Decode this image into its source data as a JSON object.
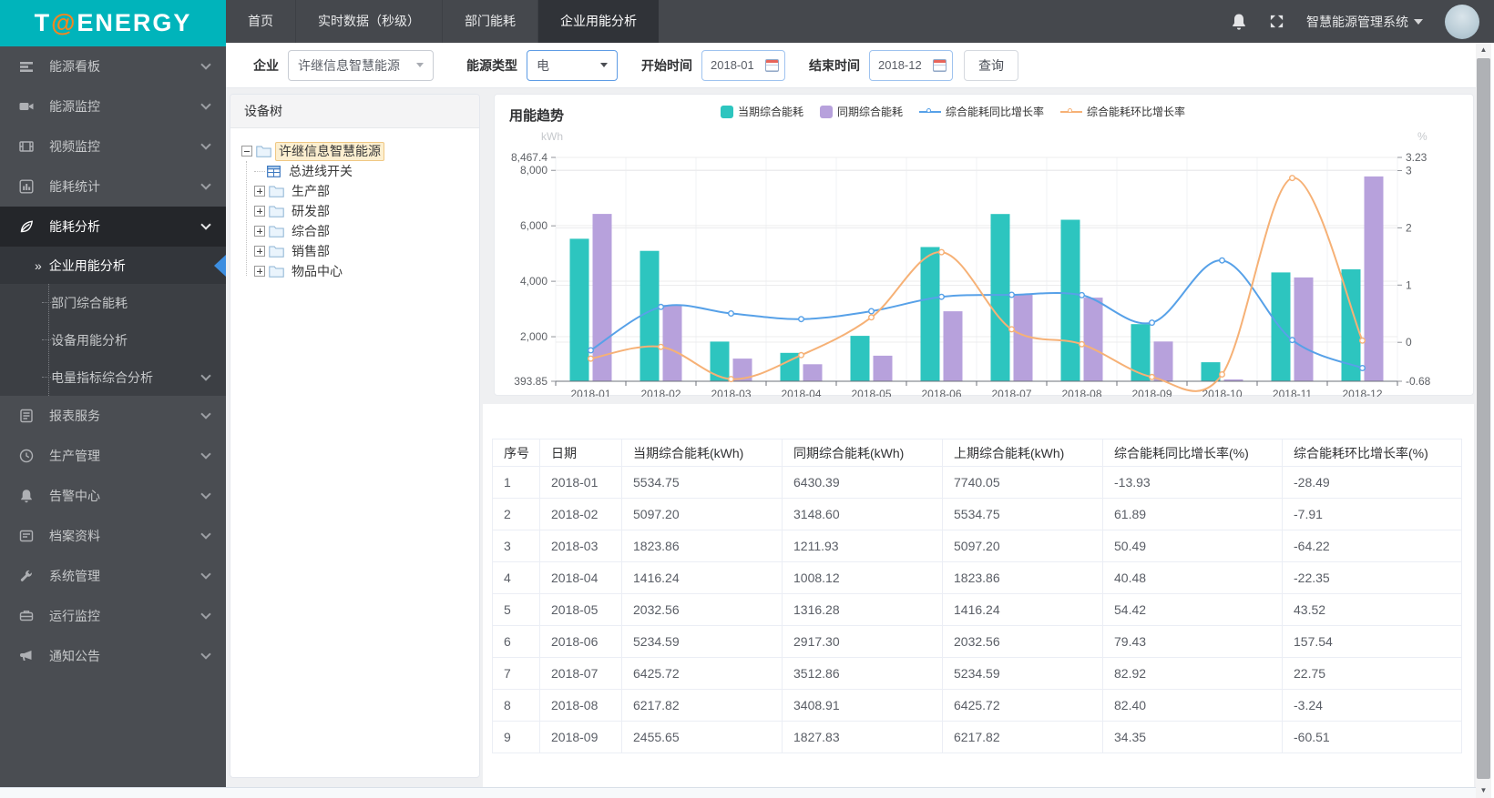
{
  "header": {
    "logo_part1": "T",
    "logo_at": "@",
    "logo_part2": "ENERGY",
    "tabs": [
      {
        "label": "首页",
        "active": false
      },
      {
        "label": "实时数据（秒级）",
        "active": false
      },
      {
        "label": "部门能耗",
        "active": false
      },
      {
        "label": "企业用能分析",
        "active": true
      }
    ],
    "system_name": "智慧能源管理系统"
  },
  "sidebar": {
    "items": [
      {
        "label": "能源看板",
        "icon": "dashboard-icon"
      },
      {
        "label": "能源监控",
        "icon": "camera-icon"
      },
      {
        "label": "视频监控",
        "icon": "film-icon"
      },
      {
        "label": "能耗统计",
        "icon": "bar-chart-icon"
      },
      {
        "label": "能耗分析",
        "icon": "leaf-icon",
        "active": true,
        "expanded": true,
        "children": [
          {
            "label": "企业用能分析",
            "active": true
          },
          {
            "label": "部门综合能耗"
          },
          {
            "label": "设备用能分析"
          },
          {
            "label": "电量指标综合分析",
            "has_children": true
          }
        ]
      },
      {
        "label": "报表服务",
        "icon": "report-icon"
      },
      {
        "label": "生产管理",
        "icon": "clock-icon"
      },
      {
        "label": "告警中心",
        "icon": "bell-icon"
      },
      {
        "label": "档案资料",
        "icon": "card-icon"
      },
      {
        "label": "系统管理",
        "icon": "wrench-icon"
      },
      {
        "label": "运行监控",
        "icon": "drive-icon"
      },
      {
        "label": "通知公告",
        "icon": "megaphone-icon"
      }
    ]
  },
  "filters": {
    "enterprise_label": "企业",
    "enterprise_value": "许继信息智慧能源",
    "energy_type_label": "能源类型",
    "energy_type_value": "电",
    "start_label": "开始时间",
    "start_value": "2018-01",
    "end_label": "结束时间",
    "end_value": "2018-12",
    "query_label": "查询"
  },
  "tree": {
    "title": "设备树",
    "nodes": [
      {
        "label": "许继信息智慧能源",
        "level": 0,
        "expander": "minus",
        "icon": "folder",
        "selected": true
      },
      {
        "label": "总进线开关",
        "level": 1,
        "expander": "none",
        "icon": "meter",
        "selected": false
      },
      {
        "label": "生产部",
        "level": 1,
        "expander": "plus",
        "icon": "folder",
        "selected": false
      },
      {
        "label": "研发部",
        "level": 1,
        "expander": "plus",
        "icon": "folder",
        "selected": false
      },
      {
        "label": "综合部",
        "level": 1,
        "expander": "plus",
        "icon": "folder",
        "selected": false
      },
      {
        "label": "销售部",
        "level": 1,
        "expander": "plus",
        "icon": "folder",
        "selected": false
      },
      {
        "label": "物品中心",
        "level": 1,
        "expander": "plus",
        "icon": "folder",
        "selected": false
      }
    ]
  },
  "chart_data": {
    "type": "combo",
    "title": "用能趋势",
    "categories": [
      "2018-01",
      "2018-02",
      "2018-03",
      "2018-04",
      "2018-05",
      "2018-06",
      "2018-07",
      "2018-08",
      "2018-09",
      "2018-10",
      "2018-11",
      "2018-12"
    ],
    "series": [
      {
        "name": "当期综合能耗",
        "type": "bar",
        "axis": "left",
        "color": "#2DC5BF",
        "values": [
          5534.75,
          5097.2,
          1823.86,
          1416.24,
          2032.56,
          5234.59,
          6425.72,
          6217.82,
          2455.65,
          1080,
          4320,
          4430
        ]
      },
      {
        "name": "同期综合能耗",
        "type": "bar",
        "axis": "left",
        "color": "#B7A1DC",
        "values": [
          6430.39,
          3148.6,
          1211.93,
          1008.12,
          1316.28,
          2917.3,
          3512.86,
          3408.91,
          1827.83,
          460,
          4140,
          7780
        ]
      },
      {
        "name": "综合能耗同比增长率",
        "type": "line",
        "axis": "right",
        "color": "#57A1E8",
        "values": [
          -0.1393,
          0.6189,
          0.5049,
          0.4048,
          0.5442,
          0.7943,
          0.8292,
          0.824,
          0.3435,
          1.43,
          0.04,
          -0.45
        ]
      },
      {
        "name": "综合能耗环比增长率",
        "type": "line",
        "axis": "right",
        "color": "#F6B176",
        "values": [
          -0.2849,
          -0.0791,
          -0.6422,
          -0.2235,
          0.4352,
          1.5754,
          0.2275,
          -0.0324,
          -0.6051,
          -0.56,
          2.87,
          0.03
        ]
      }
    ],
    "y_left": {
      "name": "kWh",
      "min": 393.85,
      "max": 8467.4,
      "ticks": [
        {
          "v": 393.85,
          "label": "393.85"
        },
        {
          "v": 2000,
          "label": "2,000"
        },
        {
          "v": 4000,
          "label": "4,000"
        },
        {
          "v": 6000,
          "label": "6,000"
        },
        {
          "v": 8000,
          "label": "8,000"
        },
        {
          "v": 8467.4,
          "label": "8,467.4"
        }
      ]
    },
    "y_right": {
      "name": "%",
      "min": -0.68,
      "max": 3.23,
      "ticks": [
        {
          "v": -0.68,
          "label": "-0.68"
        },
        {
          "v": 0,
          "label": "0"
        },
        {
          "v": 1,
          "label": "1"
        },
        {
          "v": 2,
          "label": "2"
        },
        {
          "v": 3,
          "label": "3"
        },
        {
          "v": 3.23,
          "label": "3.23"
        }
      ]
    },
    "legend_position": "top",
    "grid": true
  },
  "table": {
    "columns": [
      "序号",
      "日期",
      "当期综合能耗(kWh)",
      "同期综合能耗(kWh)",
      "上期综合能耗(kWh)",
      "综合能耗同比增长率(%)",
      "综合能耗环比增长率(%)"
    ],
    "rows": [
      [
        "1",
        "2018-01",
        "5534.75",
        "6430.39",
        "7740.05",
        "-13.93",
        "-28.49"
      ],
      [
        "2",
        "2018-02",
        "5097.20",
        "3148.60",
        "5534.75",
        "61.89",
        "-7.91"
      ],
      [
        "3",
        "2018-03",
        "1823.86",
        "1211.93",
        "5097.20",
        "50.49",
        "-64.22"
      ],
      [
        "4",
        "2018-04",
        "1416.24",
        "1008.12",
        "1823.86",
        "40.48",
        "-22.35"
      ],
      [
        "5",
        "2018-05",
        "2032.56",
        "1316.28",
        "1416.24",
        "54.42",
        "43.52"
      ],
      [
        "6",
        "2018-06",
        "5234.59",
        "2917.30",
        "2032.56",
        "79.43",
        "157.54"
      ],
      [
        "7",
        "2018-07",
        "6425.72",
        "3512.86",
        "5234.59",
        "82.92",
        "22.75"
      ],
      [
        "8",
        "2018-08",
        "6217.82",
        "3408.91",
        "6425.72",
        "82.40",
        "-3.24"
      ],
      [
        "9",
        "2018-09",
        "2455.65",
        "1827.83",
        "6217.82",
        "34.35",
        "-60.51"
      ]
    ]
  }
}
